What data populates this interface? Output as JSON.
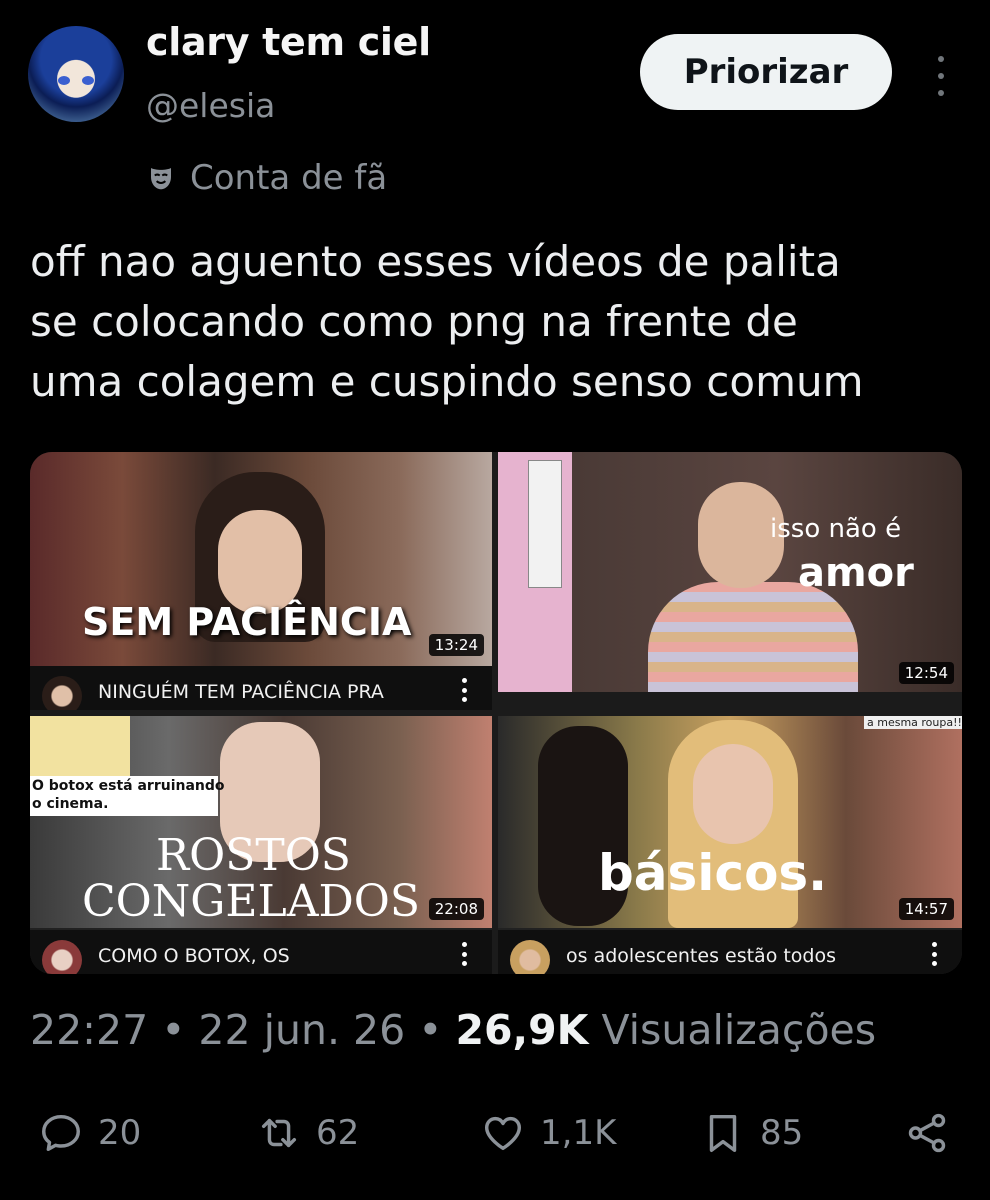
{
  "user": {
    "display_name": "clary tem ciel",
    "handle": "@elesia",
    "follow_label": "Priorizar",
    "fan_label": "Conta de fã"
  },
  "tweet": {
    "lines": [
      "off nao aguento esses vídeos de palita",
      "se colocando como png na frente de",
      "uma colagem e cuspindo senso comum"
    ]
  },
  "media": {
    "videos": [
      {
        "thumb_title": "SEM PACIÊNCIA",
        "duration": "13:24",
        "title": "NINGUÉM TEM PACIÊNCIA PRA"
      },
      {
        "thumb_title_1": "isso não é",
        "thumb_title_2": "amor",
        "duration": "12:54",
        "title": ""
      },
      {
        "thumb_caption_1": "O botox está arruinando",
        "thumb_caption_2": "o cinema.",
        "thumb_title_1": "ROSTOS",
        "thumb_title_2": "CONGELADOS",
        "duration": "22:08",
        "title": "COMO O BOTOX, OS"
      },
      {
        "thumb_title": "básicos.",
        "duration": "14:57",
        "title": "os adolescentes estão todos",
        "overlay_text": "a mesma roupa!!"
      }
    ]
  },
  "meta": {
    "time": "22:27",
    "date": "22 jun. 26",
    "views_count": "26,9K",
    "views_label": "Visualizações"
  },
  "actions": {
    "replies": "20",
    "reposts": "62",
    "likes": "1,1K",
    "bookmarks": "85"
  },
  "colors": {
    "background": "#000000",
    "muted_text": "#8b9198",
    "button_bg": "#eff3f4"
  }
}
